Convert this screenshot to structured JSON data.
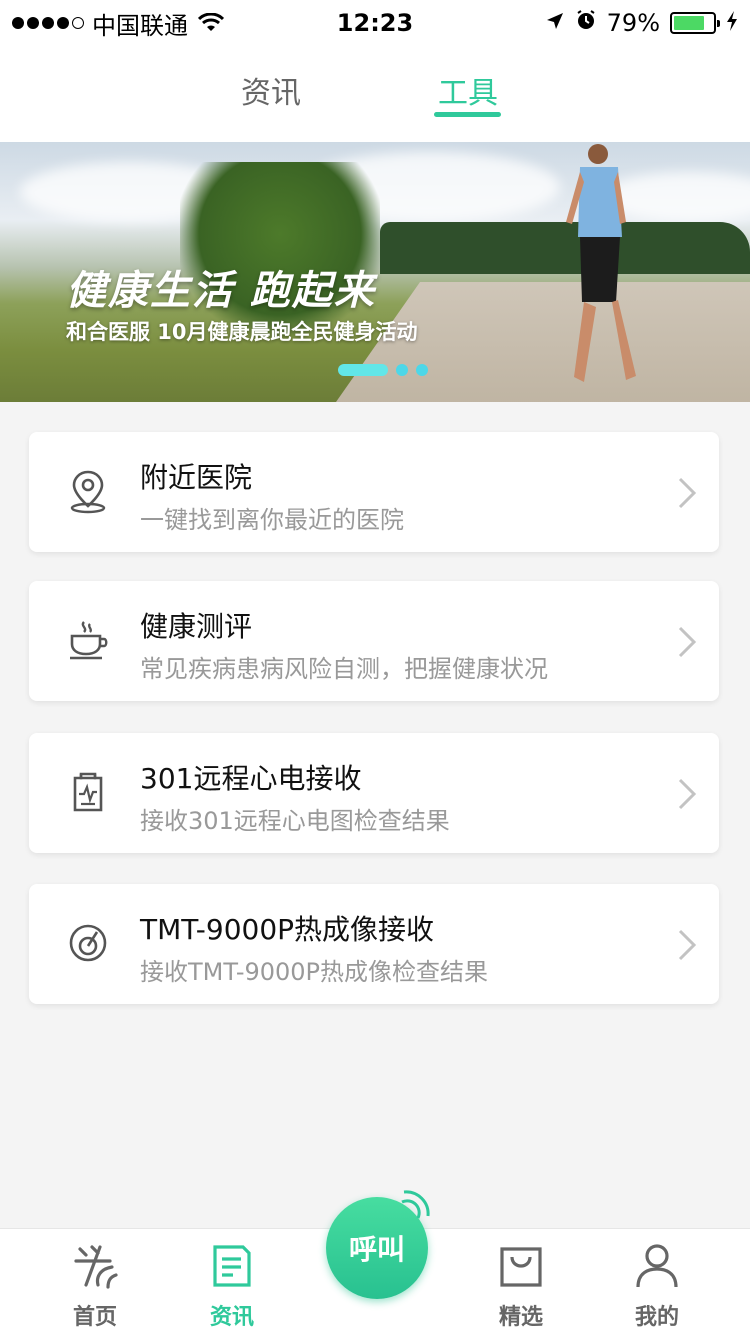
{
  "status_bar": {
    "carrier": "中国联通",
    "time": "12:23",
    "battery": "79%",
    "battery_level": 0.79
  },
  "top_tabs": [
    {
      "label": "资讯",
      "active": false
    },
    {
      "label": "工具",
      "active": true
    }
  ],
  "banner": {
    "title": "健康生活 跑起来",
    "subtitle": "和合医服 10月健康晨跑全民健身活动",
    "page_count": 3,
    "active_page": 1
  },
  "cards": [
    {
      "title": "附近医院",
      "subtitle": "一键找到离你最近的医院",
      "icon": "location-pin-icon"
    },
    {
      "title": "健康测评",
      "subtitle": "常见疾病患病风险自测，把握健康状况",
      "icon": "coffee-cup-icon"
    },
    {
      "title": "301远程心电接收",
      "subtitle": "接收301远程心电图检查结果",
      "icon": "ecg-report-icon"
    },
    {
      "title": "TMT-9000P热成像接收",
      "subtitle": "接收TMT-9000P热成像检查结果",
      "icon": "thermal-scan-icon"
    }
  ],
  "bottom_nav": {
    "items": [
      {
        "label": "首页",
        "icon": "home-icon",
        "active": false
      },
      {
        "label": "资讯",
        "icon": "news-icon",
        "active": true
      },
      {
        "label": "精选",
        "icon": "shopping-bag-icon",
        "active": false
      },
      {
        "label": "我的",
        "icon": "person-icon",
        "active": false
      }
    ],
    "call_label": "呼叫"
  },
  "colors": {
    "accent": "#2fc99b",
    "text_primary": "#111111",
    "text_secondary": "#999999",
    "background": "#f4f4f4"
  }
}
